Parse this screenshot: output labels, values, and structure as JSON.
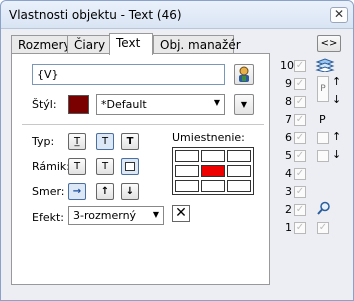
{
  "window": {
    "title": "Vlastnosti objektu - Text (46)",
    "close_symbol": "✕"
  },
  "tabs": [
    {
      "label": "Rozmery"
    },
    {
      "label": "Čiary"
    },
    {
      "label": "Text",
      "active": true
    },
    {
      "label": "Obj. manažér"
    }
  ],
  "nav_button": "<>",
  "text_panel": {
    "text_value": "{V}",
    "style_label": "Štýl:",
    "style_color": "#7a0000",
    "style_value": "*Default",
    "type_label": "Typ:",
    "frame_label": "Rámik:",
    "direction_label": "Smer:",
    "effect_label": "Efekt:",
    "effect_value": "3-rozmerný",
    "placement_label": "Umiestnenie:",
    "placement_selected_color": "#ee0000",
    "type_buttons": [
      "T̲",
      "T",
      "T"
    ],
    "frame_buttons": [
      "T",
      "T",
      ""
    ],
    "direction_buttons": [
      "→",
      "↑",
      "↓"
    ]
  },
  "layers": {
    "numbers": [
      "10",
      "9",
      "8",
      "7",
      "6",
      "5",
      "4",
      "3",
      "2",
      "1"
    ],
    "p_label": "P",
    "p_label_2": "P"
  }
}
